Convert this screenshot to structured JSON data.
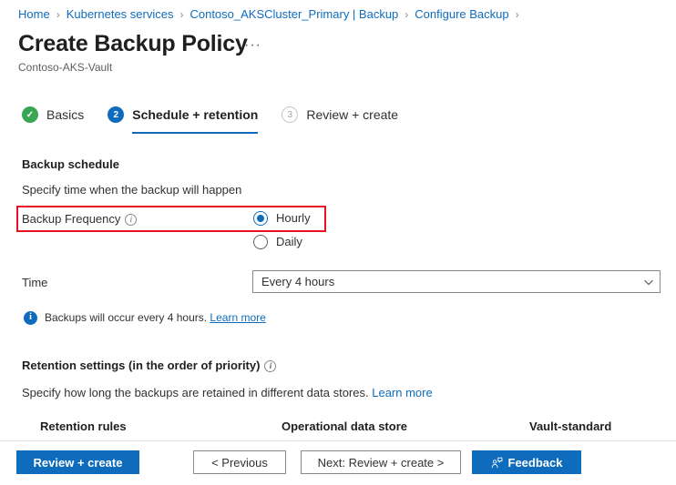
{
  "breadcrumb": {
    "separator": "›",
    "items": [
      {
        "label": "Home"
      },
      {
        "label": "Kubernetes services"
      },
      {
        "label": "Contoso_AKSCluster_Primary | Backup"
      },
      {
        "label": "Configure Backup"
      }
    ]
  },
  "header": {
    "title": "Create Backup Policy",
    "ellipsis": "···",
    "subtitle": "Contoso-AKS-Vault"
  },
  "steps": [
    {
      "icon": "check-icon",
      "marker": "✓",
      "label": "Basics",
      "state": "done"
    },
    {
      "icon": "step-number-2",
      "marker": "2",
      "label": "Schedule + retention",
      "state": "current"
    },
    {
      "icon": "step-number-3",
      "marker": "3",
      "label": "Review + create",
      "state": "pending"
    }
  ],
  "backup_schedule": {
    "heading": "Backup schedule",
    "description": "Specify time when the backup will happen",
    "frequency": {
      "label": "Backup Frequency",
      "info_glyph": "i",
      "options": [
        {
          "label": "Hourly",
          "selected": true
        },
        {
          "label": "Daily",
          "selected": false
        }
      ]
    },
    "time": {
      "label": "Time",
      "value": "Every 4 hours",
      "chevron": "chevron-down-icon"
    },
    "info_message": {
      "glyph": "i",
      "text": "Backups will occur every 4 hours.",
      "link": "Learn more"
    }
  },
  "retention": {
    "heading": "Retention settings (in the order of priority)",
    "info_glyph": "i",
    "description": "Specify how long the backups are retained in different data stores.",
    "link": "Learn more",
    "columns": [
      {
        "label": "Retention rules"
      },
      {
        "label": "Operational data store"
      },
      {
        "label": "Vault-standard"
      }
    ]
  },
  "footer": {
    "review_create": "Review + create",
    "previous": "< Previous",
    "next": "Next: Review + create >",
    "feedback": "Feedback",
    "feedback_icon": "feedback-person-icon"
  },
  "annotation": {
    "highlight_color": "#e81123"
  },
  "colors": {
    "accent": "#0f6cbd",
    "success": "#3aa655",
    "link": "#0f6cbd",
    "highlight": "#e81123"
  }
}
